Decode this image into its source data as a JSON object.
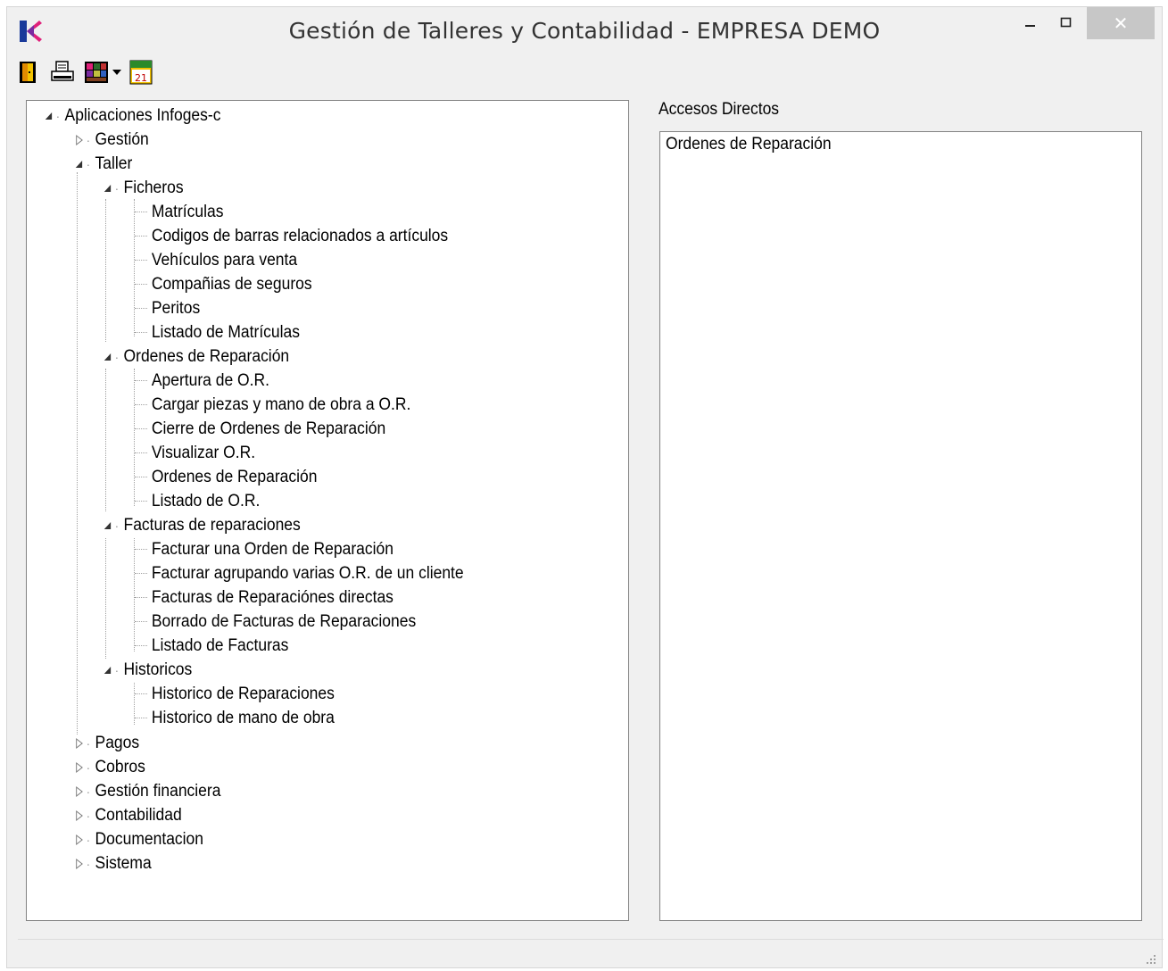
{
  "window": {
    "title": "Gestión de Talleres y Contabilidad - EMPRESA DEMO",
    "minimize_glyph": "–",
    "maximize_glyph": "☐",
    "close_glyph": "✕"
  },
  "toolbar": {
    "buttons": [
      {
        "icon": "exit-door-icon"
      },
      {
        "icon": "printer-icon"
      },
      {
        "icon": "palette-icon",
        "has_dropdown": true
      },
      {
        "icon": "calendar-icon",
        "text": "21"
      }
    ]
  },
  "tree": {
    "root": "Aplicaciones Infoges-c",
    "gestion": "Gestión",
    "taller": "Taller",
    "ficheros": {
      "label": "Ficheros",
      "items": [
        "Matrículas",
        "Codigos de barras relacionados a artículos",
        "Vehículos para venta",
        "Compañias de seguros",
        "Peritos",
        "Listado de Matrículas"
      ]
    },
    "ordenes": {
      "label": "Ordenes de Reparación",
      "items": [
        "Apertura de O.R.",
        "Cargar piezas y mano de obra a O.R.",
        "Cierre de Ordenes de Reparación",
        "Visualizar O.R.",
        "Ordenes de Reparación",
        "Listado de O.R."
      ]
    },
    "facturas": {
      "label": "Facturas de reparaciones",
      "items": [
        "Facturar una Orden de Reparación",
        "Facturar agrupando varias O.R. de un cliente",
        "Facturas de Reparaciónes directas",
        "Borrado de Facturas de Reparaciones",
        "Listado de Facturas"
      ]
    },
    "historicos": {
      "label": "Historicos",
      "items": [
        "Historico de Reparaciones",
        "Historico de mano de obra"
      ]
    },
    "others": [
      "Pagos",
      "Cobros",
      "Gestión financiera",
      "Contabilidad",
      "Documentacion",
      "Sistema"
    ]
  },
  "shortcuts": {
    "label": "Accesos Directos",
    "items": [
      "Ordenes de Reparación"
    ]
  },
  "colors": {
    "window_bg": "#f0f0f0",
    "panel_border": "#828282",
    "close_button": "#c7c7c7",
    "logo_magenta": "#e0207a",
    "logo_blue": "#1a3a9a"
  }
}
